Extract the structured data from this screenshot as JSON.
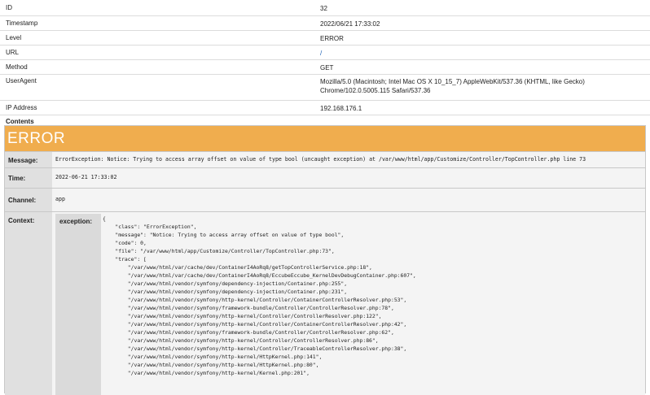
{
  "info": {
    "id_label": "ID",
    "id_value": "32",
    "timestamp_label": "Timestamp",
    "timestamp_value": "2022/06/21 17:33:02",
    "level_label": "Level",
    "level_value": "ERROR",
    "url_label": "URL",
    "url_value": "/",
    "method_label": "Method",
    "method_value": "GET",
    "useragent_label": "UserAgent",
    "useragent_line1": "Mozilla/5.0 (Macintosh; Intel Mac OS X 10_15_7) AppleWebKit/537.36 (KHTML, like Gecko)",
    "useragent_line2": "Chrome/102.0.5005.115 Safari/537.36",
    "ip_label": "IP Address",
    "ip_value": "192.168.176.1",
    "contents_label": "Contents"
  },
  "error": {
    "header": "ERROR",
    "message_label": "Message:",
    "message_value": "ErrorException: Notice: Trying to access array offset on value of type bool (uncaught exception) at /var/www/html/app/Customize/Controller/TopController.php line 73",
    "time_label": "Time:",
    "time_value": "2022-06-21 17:33:02",
    "channel_label": "Channel:",
    "channel_value": "app",
    "context_label": "Context:",
    "exception_label": "exception:",
    "exception_lines": [
      "{",
      "    \"class\": \"ErrorException\",",
      "    \"message\": \"Notice: Trying to access array offset on value of type bool\",",
      "    \"code\": 0,",
      "    \"file\": \"/var/www/html/app/Customize/Controller/TopController.php:73\",",
      "    \"trace\": [",
      "        \"/var/www/html/var/cache/dev/ContainerI4AoRq8/getTopControllerService.php:18\",",
      "        \"/var/www/html/var/cache/dev/ContainerI4AoRq8/EccubeEccube_KernelDevDebugContainer.php:607\",",
      "        \"/var/www/html/vendor/symfony/dependency-injection/Container.php:255\",",
      "        \"/var/www/html/vendor/symfony/dependency-injection/Container.php:231\",",
      "        \"/var/www/html/vendor/symfony/http-kernel/Controller/ContainerControllerResolver.php:53\",",
      "        \"/var/www/html/vendor/symfony/framework-bundle/Controller/ControllerResolver.php:78\",",
      "        \"/var/www/html/vendor/symfony/http-kernel/Controller/ControllerResolver.php:122\",",
      "        \"/var/www/html/vendor/symfony/http-kernel/Controller/ContainerControllerResolver.php:42\",",
      "        \"/var/www/html/vendor/symfony/framework-bundle/Controller/ControllerResolver.php:62\",",
      "        \"/var/www/html/vendor/symfony/http-kernel/Controller/ControllerResolver.php:86\",",
      "        \"/var/www/html/vendor/symfony/http-kernel/Controller/TraceableControllerResolver.php:38\",",
      "        \"/var/www/html/vendor/symfony/http-kernel/HttpKernel.php:141\",",
      "        \"/var/www/html/vendor/symfony/http-kernel/HttpKernel.php:80\",",
      "        \"/var/www/html/vendor/symfony/http-kernel/Kernel.php:201\","
    ]
  }
}
